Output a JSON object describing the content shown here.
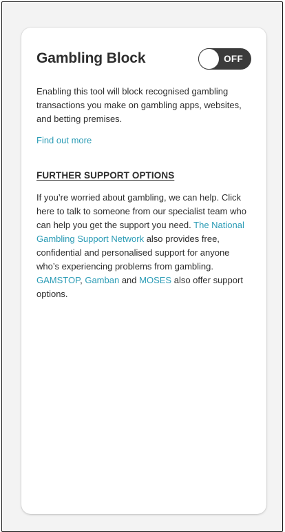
{
  "card": {
    "title": "Gambling Block",
    "toggle": {
      "state_label": "OFF",
      "on": false
    },
    "description": "Enabling this tool will block recognised gambling transactions you make on gambling apps, websites, and betting premises.",
    "find_out_more": "Find out more"
  },
  "support": {
    "heading": "FURTHER SUPPORT OPTIONS",
    "body_intro": "If you’re worried about gambling, we can help. Click here to talk to someone from our specialist team who can help you get the support you need. ",
    "link_network": "The National Gambling Support Network",
    "body_mid": " also provides free, confidential and personalised support for anyone who’s experiencing problems from gambling. ",
    "link_gamstop": "GAMSTOP",
    "comma": ", ",
    "link_gamban": "Gamban",
    "and": " and ",
    "link_moses": "MOSES",
    "body_end": " also offer support options."
  },
  "colors": {
    "link": "#2a9bb5",
    "toggle_off": "#3b3b3b",
    "text": "#2d2d2d"
  }
}
